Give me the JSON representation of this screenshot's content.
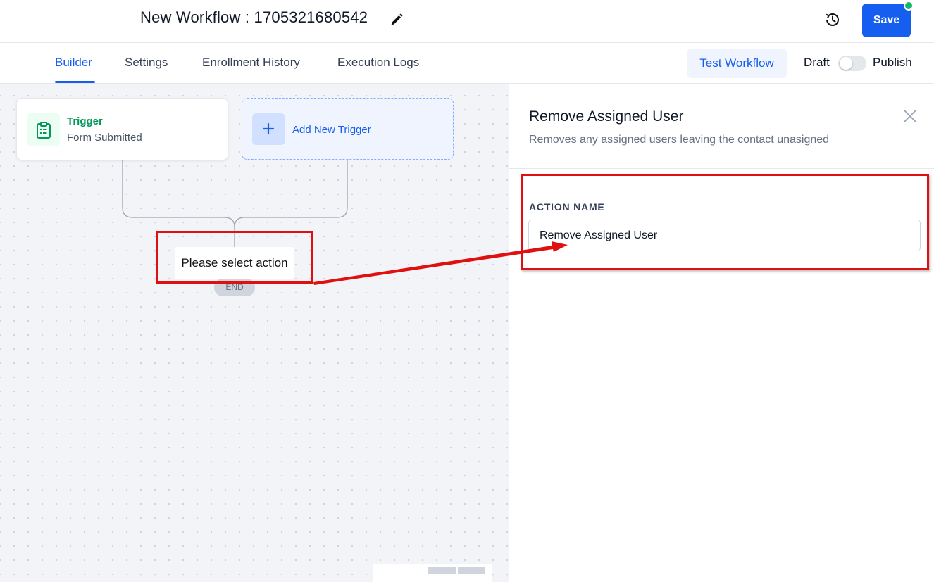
{
  "header": {
    "workflow_title": "New Workflow : 1705321680542",
    "save_label": "Save"
  },
  "tabs": [
    {
      "label": "Builder",
      "active": true
    },
    {
      "label": "Settings",
      "active": false
    },
    {
      "label": "Enrollment History",
      "active": false
    },
    {
      "label": "Execution Logs",
      "active": false
    }
  ],
  "toolbar": {
    "test_workflow_label": "Test Workflow",
    "draft_label": "Draft",
    "publish_label": "Publish",
    "publish_toggle_on": false
  },
  "canvas": {
    "trigger": {
      "title": "Trigger",
      "subtitle": "Form Submitted"
    },
    "add_trigger_label": "Add New Trigger",
    "select_action_label": "Please select action",
    "end_label": "END"
  },
  "panel": {
    "title": "Remove Assigned User",
    "description": "Removes any assigned users leaving the contact unasigned",
    "field_label": "ACTION NAME",
    "field_value": "Remove Assigned User"
  },
  "colors": {
    "primary": "#155eef",
    "trigger_green": "#039855",
    "annotation_red": "#e11010",
    "status_dot": "#12b76a"
  },
  "icons": [
    "pencil-icon",
    "history-icon",
    "clipboard-icon",
    "plus-icon",
    "close-icon"
  ]
}
